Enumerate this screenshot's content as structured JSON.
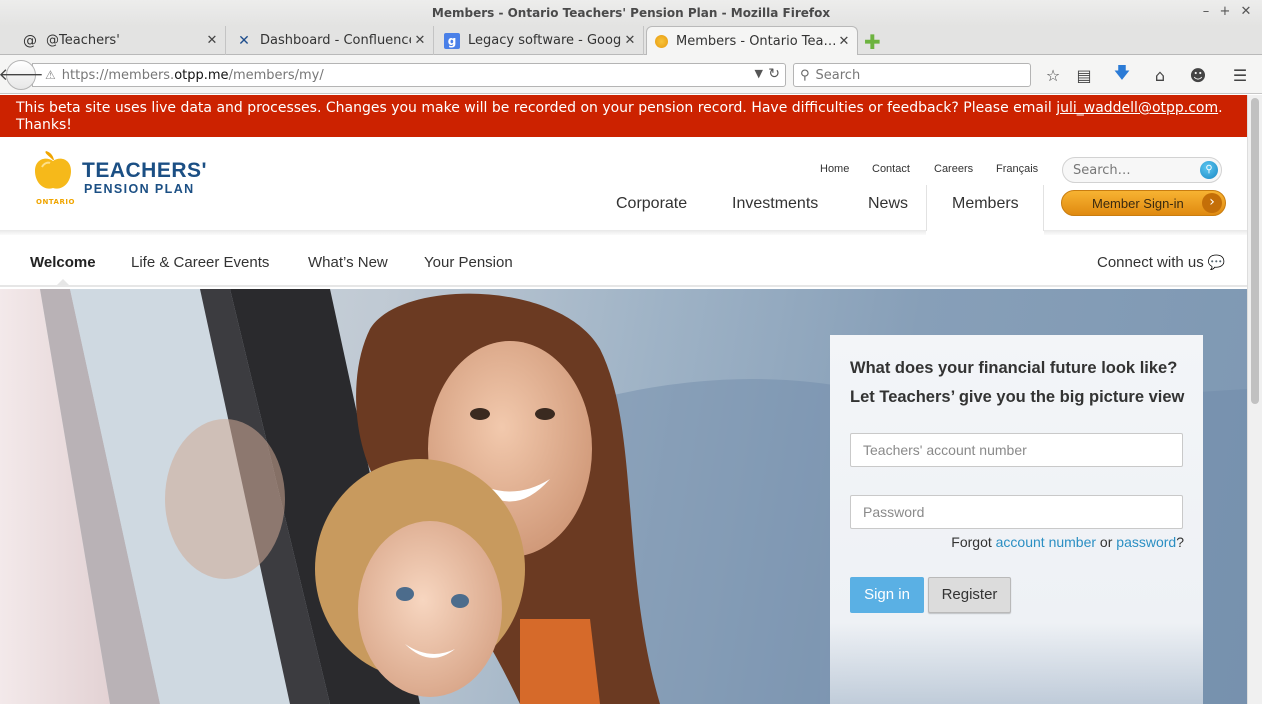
{
  "browser": {
    "window_title": "Members - Ontario Teachers' Pension Plan - Mozilla Firefox",
    "tabs": [
      {
        "label": "@Teachers'",
        "icon": "at-icon"
      },
      {
        "label": "Dashboard - Confluence",
        "icon": "confluence-icon"
      },
      {
        "label": "Legacy software - Googl…",
        "icon": "google-icon"
      },
      {
        "label": "Members - Ontario Tea…",
        "icon": "otpp-apple-icon"
      }
    ],
    "url_prefix": "https://members.",
    "url_domain": "otpp.me",
    "url_path": "/members/my/",
    "search_placeholder": "Search"
  },
  "beta_banner": {
    "text_before": "This beta site uses live data and processes. Changes you make will be recorded on your pension record. Have difficulties or feedback? Please email ",
    "email": "juli_waddell@otpp.com",
    "text_after": ". Thanks!"
  },
  "header": {
    "logo_line1": "TEACHERS'",
    "logo_line2": "PENSION PLAN",
    "logo_ontario": "ONTARIO",
    "utility_links": [
      "Home",
      "Contact",
      "Careers",
      "Français"
    ],
    "search_placeholder": "Search…",
    "main_nav": [
      "Corporate",
      "Investments",
      "News",
      "Members"
    ],
    "member_signin": "Member Sign-in"
  },
  "subnav": {
    "items": [
      "Welcome",
      "Life & Career Events",
      "What’s New",
      "Your Pension"
    ],
    "active": "Welcome",
    "connect": "Connect with us"
  },
  "login": {
    "heading1": "What does your financial future look like?",
    "heading2": "Let Teachers’ give you the big picture view",
    "account_placeholder": "Teachers' account number",
    "password_placeholder": "Password",
    "forgot_prefix": "Forgot ",
    "forgot_account": "account number",
    "forgot_or": " or ",
    "forgot_password": "password",
    "forgot_suffix": "?",
    "signin_label": "Sign in",
    "register_label": "Register"
  },
  "colors": {
    "beta_banner": "#cc2200",
    "brand_blue": "#1b4f84",
    "brand_orange": "#f0a500",
    "signin_blue": "#5ab0e4",
    "link_blue": "#2b8fc3"
  }
}
